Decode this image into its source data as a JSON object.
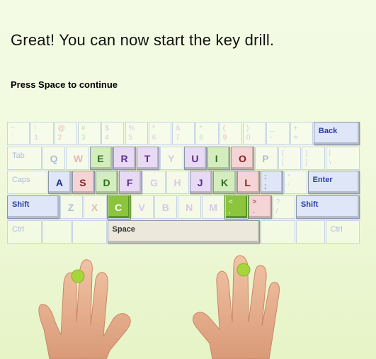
{
  "heading": "Great! You can now start the key drill.",
  "prompt": "Press Space to continue",
  "keyboard": {
    "rows": [
      [
        {
          "id": "backtick",
          "shift": "~",
          "base": "`",
          "c": "#c8d0e0",
          "w": 1
        },
        {
          "id": "1",
          "shift": "!",
          "base": "1",
          "c": "#c8d0e0",
          "w": 1
        },
        {
          "id": "2",
          "shift": "@",
          "base": "2",
          "c": "#e6b8b8",
          "w": 1
        },
        {
          "id": "3",
          "shift": "#",
          "base": "3",
          "c": "#bfe0b0",
          "w": 1
        },
        {
          "id": "4",
          "shift": "$",
          "base": "4",
          "c": "#d8c8e8",
          "w": 1
        },
        {
          "id": "5",
          "shift": "%",
          "base": "5",
          "c": "#d8c8e8",
          "w": 1
        },
        {
          "id": "6",
          "shift": "^",
          "base": "6",
          "c": "#d8c8e8",
          "w": 1
        },
        {
          "id": "7",
          "shift": "&",
          "base": "7",
          "c": "#d8c8e8",
          "w": 1
        },
        {
          "id": "8",
          "shift": "*",
          "base": "8",
          "c": "#bfe0b0",
          "w": 1
        },
        {
          "id": "9",
          "shift": "(",
          "base": "9",
          "c": "#e6b8b8",
          "w": 1
        },
        {
          "id": "0",
          "shift": ")",
          "base": "0",
          "c": "#c8d0e0",
          "w": 1
        },
        {
          "id": "minus",
          "shift": "_",
          "base": "-",
          "c": "#c8d0e0",
          "w": 1
        },
        {
          "id": "equals",
          "shift": "+",
          "base": "=",
          "c": "#c8d0e0",
          "w": 1
        },
        {
          "id": "back",
          "label": "Back",
          "c": "#2a3ea0",
          "w": 2,
          "active": true,
          "bg": "#dfe6f8"
        }
      ],
      [
        {
          "id": "tab",
          "label": "Tab",
          "c": "#b0bcd8",
          "w": 1.5
        },
        {
          "id": "q",
          "main": "Q",
          "c": "#b0bcd8",
          "w": 1
        },
        {
          "id": "w",
          "main": "W",
          "c": "#e6b8b8",
          "w": 1
        },
        {
          "id": "e",
          "main": "E",
          "c": "#2e6e1e",
          "w": 1,
          "active": true,
          "bg": "#d4edbf"
        },
        {
          "id": "r",
          "main": "R",
          "c": "#5a2e8a",
          "w": 1,
          "active": true,
          "bg": "#e8daf4"
        },
        {
          "id": "t",
          "main": "T",
          "c": "#5a2e8a",
          "w": 1,
          "active": true,
          "bg": "#e8daf4"
        },
        {
          "id": "y",
          "main": "Y",
          "c": "#d8c8e8",
          "w": 1
        },
        {
          "id": "u",
          "main": "U",
          "c": "#5a2e8a",
          "w": 1,
          "active": true,
          "bg": "#e8daf4"
        },
        {
          "id": "i",
          "main": "I",
          "c": "#2e6e1e",
          "w": 1,
          "active": true,
          "bg": "#d4edbf"
        },
        {
          "id": "o",
          "main": "O",
          "c": "#8a1e1e",
          "w": 1,
          "active": true,
          "bg": "#f4d4d4"
        },
        {
          "id": "p",
          "main": "P",
          "c": "#b0bcd8",
          "w": 1
        },
        {
          "id": "lbracket",
          "shift": "{",
          "base": "[",
          "c": "#c8d0e0",
          "w": 1
        },
        {
          "id": "rbracket",
          "shift": "}",
          "base": "]",
          "c": "#c8d0e0",
          "w": 1
        },
        {
          "id": "backslash",
          "shift": "|",
          "base": "\\",
          "c": "#c8d0e0",
          "w": 1.5
        }
      ],
      [
        {
          "id": "caps",
          "label": "Caps",
          "c": "#b0bcd8",
          "w": 1.75
        },
        {
          "id": "a",
          "main": "A",
          "c": "#22347a",
          "w": 1,
          "active": true,
          "bg": "#dfe6f8"
        },
        {
          "id": "s",
          "main": "S",
          "c": "#8a1e1e",
          "w": 1,
          "active": true,
          "bg": "#f4d4d4"
        },
        {
          "id": "d",
          "main": "D",
          "c": "#2e6e1e",
          "w": 1,
          "active": true,
          "bg": "#d4edbf"
        },
        {
          "id": "f",
          "main": "F",
          "c": "#5a2e8a",
          "w": 1,
          "active": true,
          "bg": "#e8daf4"
        },
        {
          "id": "g",
          "main": "G",
          "c": "#d8c8e8",
          "w": 1
        },
        {
          "id": "h",
          "main": "H",
          "c": "#d8c8e8",
          "w": 1
        },
        {
          "id": "j",
          "main": "J",
          "c": "#5a2e8a",
          "w": 1,
          "active": true,
          "bg": "#e8daf4"
        },
        {
          "id": "k",
          "main": "K",
          "c": "#2e6e1e",
          "w": 1,
          "active": true,
          "bg": "#d4edbf"
        },
        {
          "id": "l",
          "main": "L",
          "c": "#8a1e1e",
          "w": 1,
          "active": true,
          "bg": "#f4d4d4"
        },
        {
          "id": "semicolon",
          "shift": ":",
          "base": ";",
          "c": "#22347a",
          "w": 1,
          "active": true,
          "bg": "#dfe6f8"
        },
        {
          "id": "quote",
          "shift": "\"",
          "base": "'",
          "c": "#c8d0e0",
          "w": 1
        },
        {
          "id": "enter",
          "label": "Enter",
          "c": "#2a3ea0",
          "w": 2.25,
          "active": true,
          "bg": "#dfe6f8"
        }
      ],
      [
        {
          "id": "lshift",
          "label": "Shift",
          "c": "#2a3ea0",
          "w": 2.25,
          "active": true,
          "bg": "#dfe6f8"
        },
        {
          "id": "z",
          "main": "Z",
          "c": "#b0bcd8",
          "w": 1
        },
        {
          "id": "x",
          "main": "X",
          "c": "#e6b8b8",
          "w": 1
        },
        {
          "id": "c",
          "main": "C",
          "c": "#ffffff",
          "w": 1,
          "target": true,
          "bg": "#8cc43e"
        },
        {
          "id": "v",
          "main": "V",
          "c": "#d8c8e8",
          "w": 1
        },
        {
          "id": "b",
          "main": "B",
          "c": "#d8c8e8",
          "w": 1
        },
        {
          "id": "n",
          "main": "N",
          "c": "#d8c8e8",
          "w": 1
        },
        {
          "id": "m",
          "main": "M",
          "c": "#d8c8e8",
          "w": 1
        },
        {
          "id": "comma",
          "shift": "<",
          "base": ",",
          "c": "#ffffff",
          "w": 1,
          "target": true,
          "bg": "#8cc43e"
        },
        {
          "id": "period",
          "shift": ">",
          "base": ".",
          "c": "#8a1e1e",
          "w": 1,
          "active": true,
          "bg": "#f4d4d4"
        },
        {
          "id": "slash",
          "shift": "?",
          "base": "/",
          "c": "#c8d0e0",
          "w": 1
        },
        {
          "id": "rshift",
          "label": "Shift",
          "c": "#2a3ea0",
          "w": 2.75,
          "active": true,
          "bg": "#dfe6f8"
        }
      ],
      [
        {
          "id": "lctrl",
          "label": "Ctrl",
          "c": "#b0bcd8",
          "w": 1.5
        },
        {
          "id": "lwin",
          "label": "",
          "c": "#c8d0e0",
          "w": 1.25
        },
        {
          "id": "lalt",
          "label": "",
          "c": "#c8d0e0",
          "w": 1.5
        },
        {
          "id": "space",
          "label": "Space",
          "c": "#333333",
          "w": 6.5,
          "active": true,
          "bg": "#ece8dc"
        },
        {
          "id": "ralt",
          "label": "",
          "c": "#c8d0e0",
          "w": 1.5
        },
        {
          "id": "rwin",
          "label": "",
          "c": "#c8d0e0",
          "w": 1.25
        },
        {
          "id": "rctrl",
          "label": "Ctrl",
          "c": "#b0bcd8",
          "w": 1.5
        }
      ]
    ]
  },
  "finger_markers": {
    "left": "left-middle-finger",
    "right": "right-middle-finger"
  },
  "colors": {
    "target_key": "#8cc43e",
    "finger_marker": "#a6d63a"
  }
}
